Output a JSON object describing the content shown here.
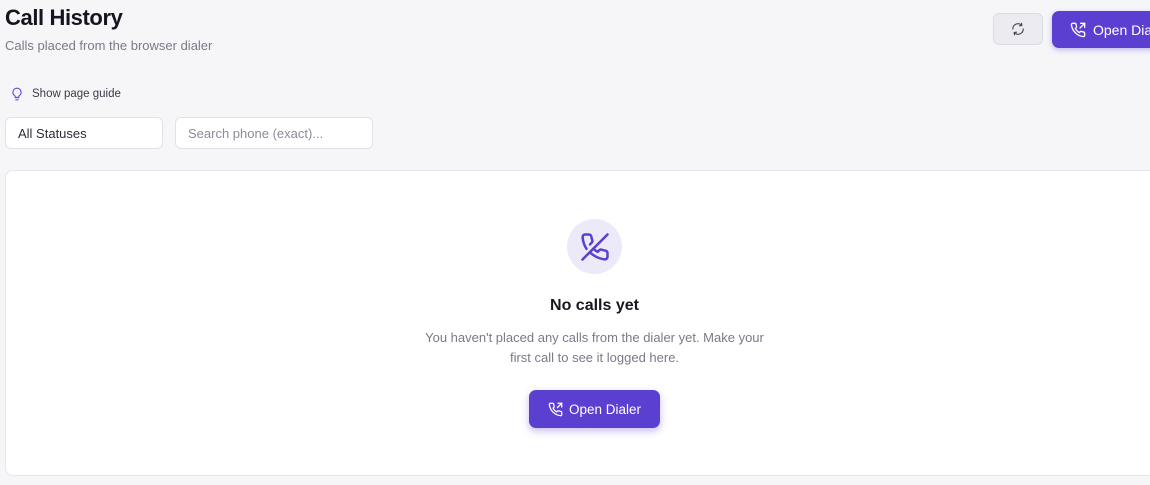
{
  "header": {
    "title": "Call History",
    "subtitle": "Calls placed from the browser dialer",
    "refresh_icon": "refresh-icon",
    "dialer_button_label": "Open Dialer",
    "dialer_icon": "phone-outgoing-icon"
  },
  "guide": {
    "label": "Show page guide",
    "icon": "lightbulb-icon"
  },
  "filters": {
    "status_selected": "All Statuses",
    "search_placeholder": "Search phone (exact)...",
    "search_value": ""
  },
  "empty_state": {
    "icon": "phone-off-icon",
    "title": "No calls yet",
    "description": "You haven't placed any calls from the dialer yet. Make your first call to see it logged here.",
    "button_label": "Open Dialer"
  },
  "colors": {
    "accent": "#5b3fd0",
    "accent_soft": "#ece9f8",
    "background": "#f6f6f9"
  }
}
